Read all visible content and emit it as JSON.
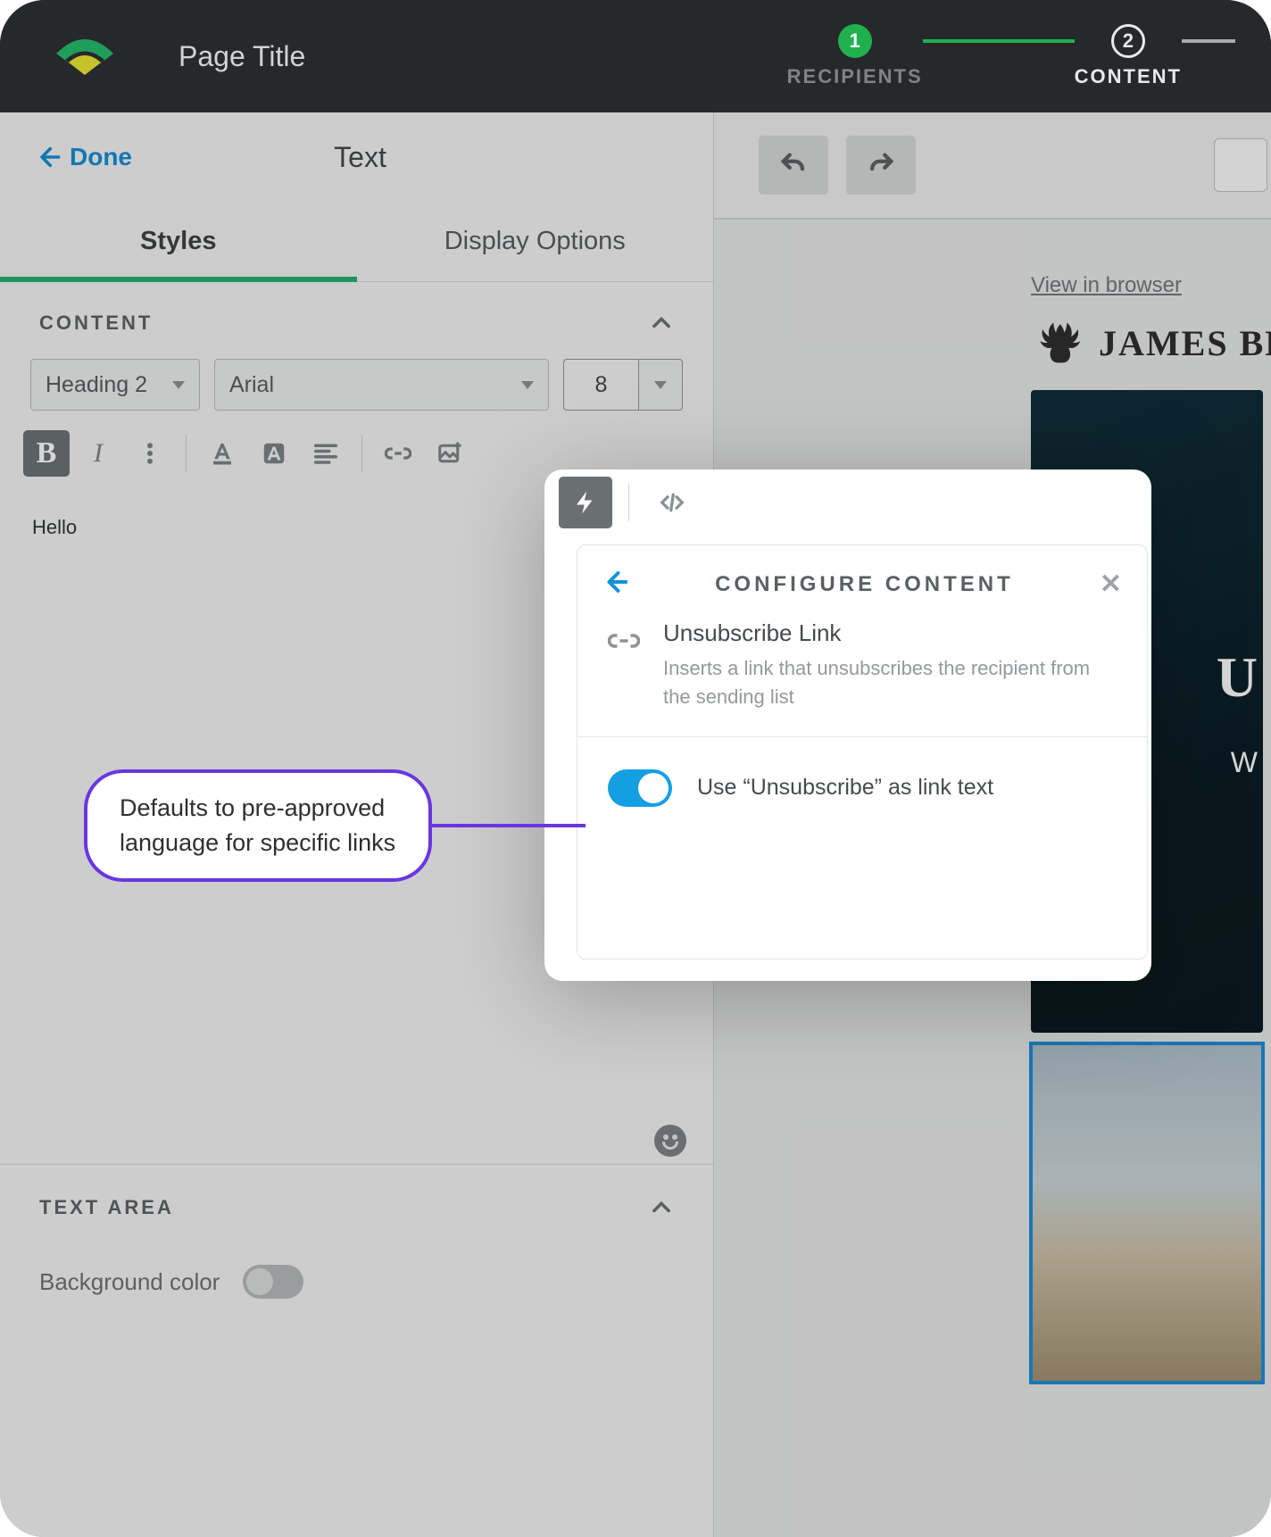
{
  "topbar": {
    "page_title": "Page Title",
    "steps": [
      {
        "num": "1",
        "label": "RECIPIENTS"
      },
      {
        "num": "2",
        "label": "CONTENT"
      }
    ]
  },
  "left": {
    "done": "Done",
    "title": "Text",
    "tabs": {
      "styles": "Styles",
      "display": "Display Options"
    },
    "content_label": "CONTENT",
    "heading_select": "Heading 2",
    "font_select": "Arial",
    "size_value": "8",
    "editor_text": "Hello",
    "textarea_label": "TEXT AREA",
    "bgcolor_label": "Background color"
  },
  "popover": {
    "title": "CONFIGURE CONTENT",
    "item_title": "Unsubscribe Link",
    "item_desc": "Inserts a link that unsubscribes the recipient from the sending list",
    "toggle_label": "Use “Unsubscribe” as link text"
  },
  "preview": {
    "view_browser": "View in browser",
    "brand": "JAMES BL",
    "hero_big": "U",
    "hero_sub": "W"
  },
  "annotation": "Defaults to pre-approved language for specific links"
}
